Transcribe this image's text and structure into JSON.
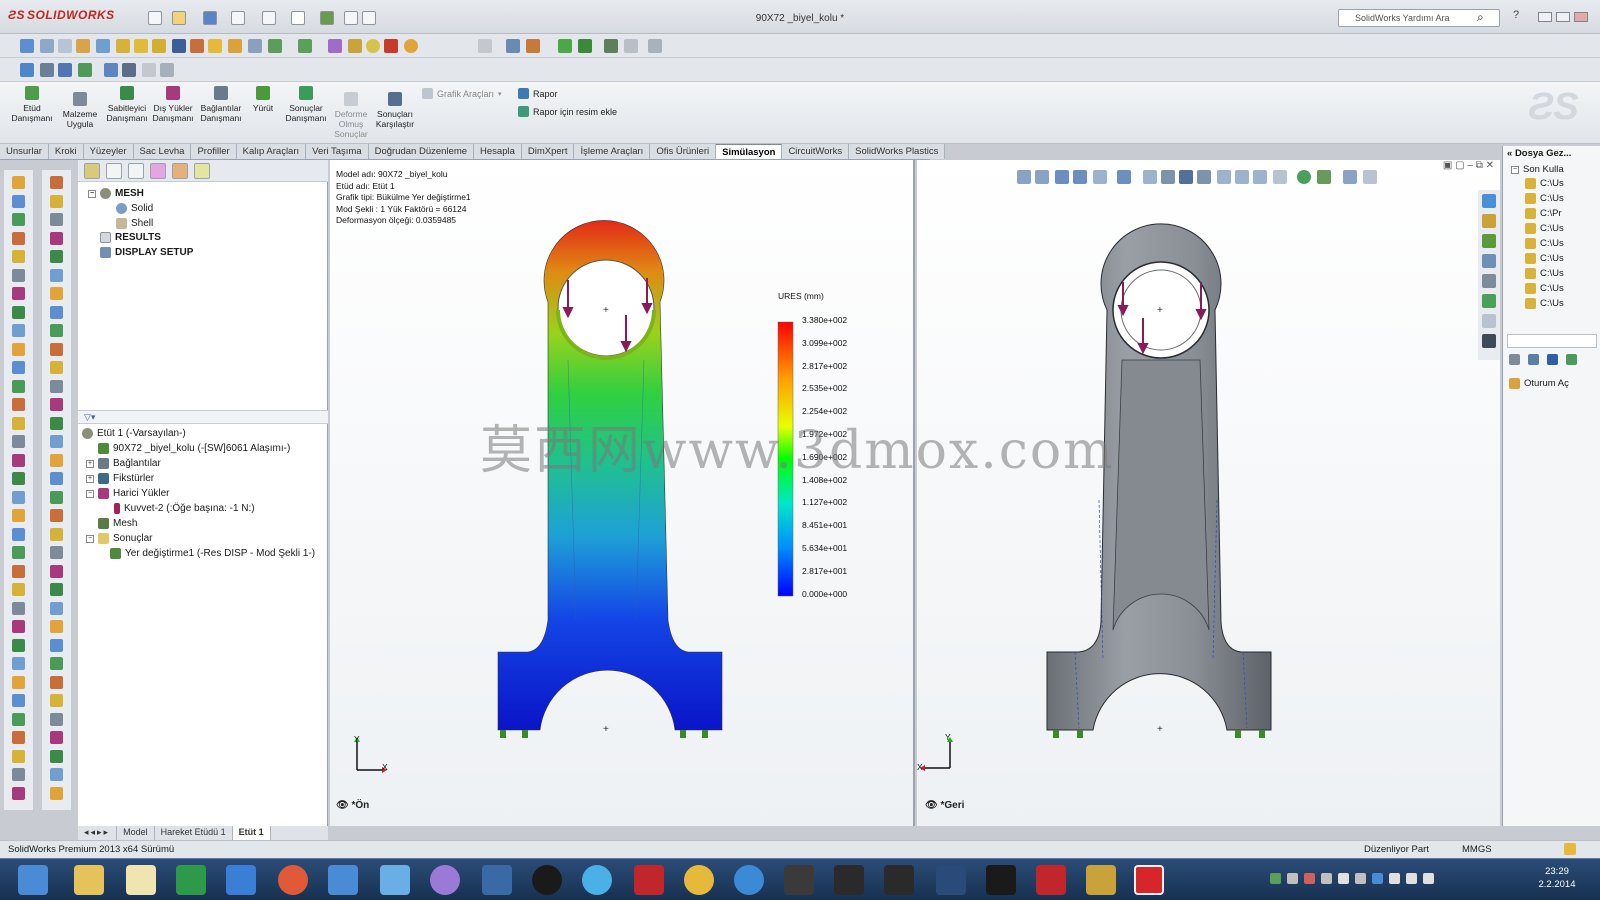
{
  "app": {
    "brand": "SOLIDWORKS",
    "window_title": "90X72 _biyel_kolu *",
    "search_placeholder": "SolidWorks Yardımı Ara"
  },
  "command_manager": {
    "buttons": [
      {
        "label": "Etüd\nDanışmanı"
      },
      {
        "label": "Malzeme\nUygula"
      },
      {
        "label": "Sabitleyici\nDanışmanı"
      },
      {
        "label": "Dış Yükler\nDanışmanı"
      },
      {
        "label": "Bağlantılar\nDanışmanı"
      },
      {
        "label": "Yürüt"
      },
      {
        "label": "Sonuçlar\nDanışmanı"
      },
      {
        "label": "Deforme\nOlmuş\nSonuçlar"
      },
      {
        "label": "Sonuçları\nKarşılaştır"
      }
    ],
    "grafik_araclari": "Grafik Araçları",
    "rapor": "Rapor",
    "rapor_resim": "Rapor için resim ekle"
  },
  "tabs": [
    "Unsurlar",
    "Kroki",
    "Yüzeyler",
    "Sac Levha",
    "Profiller",
    "Kalıp Araçları",
    "Veri Taşıma",
    "Doğrudan Düzenleme",
    "Hesapla",
    "DimXpert",
    "İşleme Araçları",
    "Ofis Ürünleri",
    "Simülasyon",
    "CircuitWorks",
    "SolidWorks Plastics"
  ],
  "active_tab": "Simülasyon",
  "panel": {
    "top_tree": [
      {
        "label": "MESH",
        "bold": true
      },
      {
        "label": "Solid"
      },
      {
        "label": "Shell"
      },
      {
        "label": "RESULTS",
        "bold": true
      },
      {
        "label": "DISPLAY SETUP",
        "bold": true
      }
    ],
    "study_tree": [
      {
        "label": "Etüt 1 (-Varsayılan-)"
      },
      {
        "label": "90X72 _biyel_kolu (-[SW]6061 Alaşımı-)"
      },
      {
        "label": "Bağlantılar"
      },
      {
        "label": "Fikstürler"
      },
      {
        "label": "Harici Yükler"
      },
      {
        "label": "Kuvvet-2 (:Öğe başına: -1 N:)"
      },
      {
        "label": "Mesh"
      },
      {
        "label": "Sonuçlar"
      },
      {
        "label": "Yer değiştirme1 (-Res DISP - Mod Şekli 1-)"
      }
    ]
  },
  "viewport_front": {
    "info": [
      "Model adı: 90X72 _biyel_kolu",
      "Etüd adı: Etüt 1",
      "Grafik tipi: Bükülme Yer değiştirme1",
      "Mod Şekli : 1   Yük Faktörü = 66124",
      "Deformasyon ölçeği: 0.0359485"
    ],
    "legend_title": "URES (mm)",
    "legend_values": [
      "3.380e+002",
      "3.099e+002",
      "2.817e+002",
      "2.535e+002",
      "2.254e+002",
      "1.972e+002",
      "1.690e+002",
      "1.408e+002",
      "1.127e+002",
      "8.451e+001",
      "5.634e+001",
      "2.817e+001",
      "0.000e+000"
    ],
    "view_name": "*Ön",
    "axis_x": "X",
    "axis_y": "Y"
  },
  "viewport_back": {
    "view_name": "*Geri",
    "axis_x": "X",
    "axis_y": "Y"
  },
  "watermark": "莫西网www.3dmox.com",
  "right_panel": {
    "title": "Dosya Gez...",
    "section": "Son Kulla",
    "recent_files": [
      "C:\\Us",
      "C:\\Us",
      "C:\\Pr",
      "C:\\Us",
      "C:\\Us",
      "C:\\Us",
      "C:\\Us",
      "C:\\Us",
      "C:\\Us"
    ],
    "oturum": "Oturum Aç"
  },
  "bottom_tabs": [
    "Model",
    "Hareket Etüdü 1",
    "Etüt 1"
  ],
  "status": {
    "left": "SolidWorks Premium 2013 x64 Sürümü",
    "mode": "Düzenliyor Part",
    "units": "MMGS"
  },
  "taskbar": {
    "time": "23:29",
    "date": "2.2.2014"
  },
  "colors": {
    "accent": "#c2261d",
    "taskbar": "#1c3a63",
    "legend_top": "#ff0000",
    "legend_bottom": "#0000ff"
  }
}
